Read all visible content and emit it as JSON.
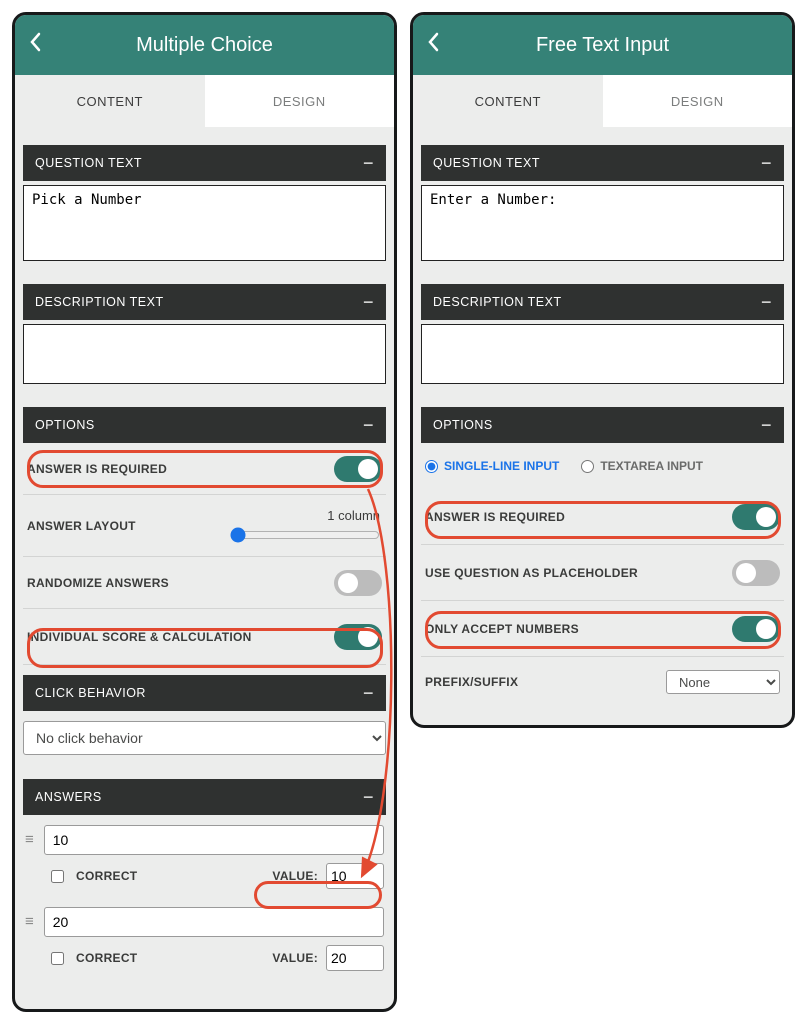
{
  "left": {
    "title": "Multiple Choice",
    "tabs": {
      "content": "CONTENT",
      "design": "DESIGN"
    },
    "sections": {
      "question": "QUESTION TEXT",
      "description": "DESCRIPTION TEXT",
      "options": "OPTIONS",
      "click": "CLICK BEHAVIOR",
      "answers": "ANSWERS"
    },
    "question_text": "Pick a Number",
    "description_text": "",
    "options": {
      "answer_required": "ANSWER IS REQUIRED",
      "answer_layout": "ANSWER LAYOUT",
      "layout_value": "1 column",
      "randomize": "RANDOMIZE ANSWERS",
      "individual_score": "INDIVIDUAL SCORE & CALCULATION"
    },
    "click_behavior": "No click behavior",
    "labels": {
      "correct": "CORRECT",
      "value": "VALUE:"
    },
    "answers": [
      {
        "text": "10",
        "correct": false,
        "value": "10"
      },
      {
        "text": "20",
        "correct": false,
        "value": "20"
      }
    ]
  },
  "right": {
    "title": "Free Text Input",
    "tabs": {
      "content": "CONTENT",
      "design": "DESIGN"
    },
    "sections": {
      "question": "QUESTION TEXT",
      "description": "DESCRIPTION TEXT",
      "options": "OPTIONS"
    },
    "question_text": "Enter a Number:",
    "description_text": "",
    "options": {
      "single_line": "SINGLE-LINE INPUT",
      "textarea": "TEXTAREA INPUT",
      "answer_required": "ANSWER IS REQUIRED",
      "use_placeholder": "USE QUESTION AS PLACEHOLDER",
      "only_numbers": "ONLY ACCEPT NUMBERS",
      "prefix_suffix": "PREFIX/SUFFIX",
      "prefix_suffix_value": "None"
    }
  }
}
